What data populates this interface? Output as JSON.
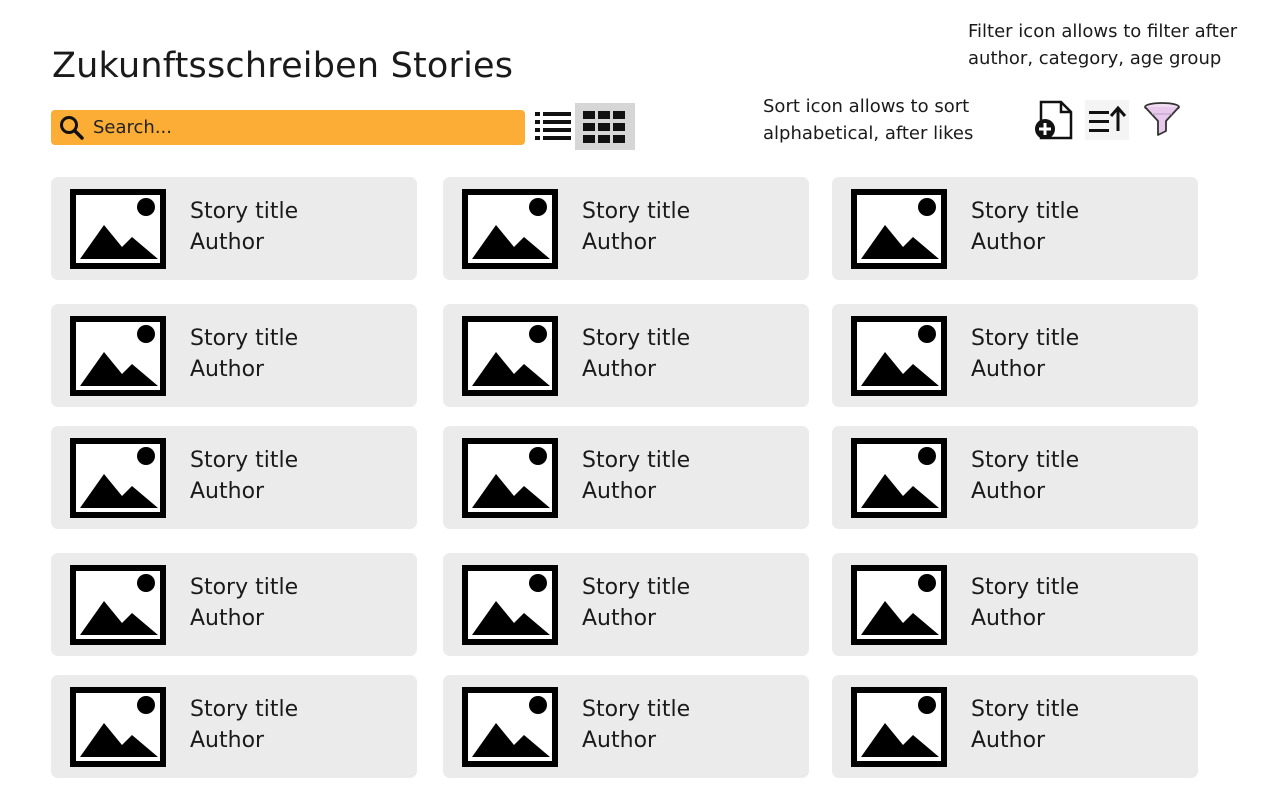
{
  "header": {
    "title": "Zukunftsschreiben Stories"
  },
  "search": {
    "placeholder": "Search...",
    "value": ""
  },
  "toolbar": {
    "view_list_icon": "list-view-icon",
    "view_grid_icon": "grid-view-icon",
    "active_view": "grid",
    "add_icon": "new-document-icon",
    "sort_icon": "sort-ascending-icon",
    "filter_icon": "funnel-icon"
  },
  "annotations": {
    "sort_note": "Sort icon allows to sort alphabetical, after likes",
    "filter_note": "Filter icon allows to filter after author, category, age group"
  },
  "colors": {
    "search_bg": "#fbad35",
    "card_bg": "#ebebeb",
    "active_view_bg": "#d6d6d6"
  },
  "stories": [
    {
      "title": "Story title",
      "author": "Author",
      "image_icon": "image-placeholder-icon"
    },
    {
      "title": "Story title",
      "author": "Author",
      "image_icon": "image-placeholder-icon"
    },
    {
      "title": "Story title",
      "author": "Author",
      "image_icon": "image-placeholder-icon"
    },
    {
      "title": "Story title",
      "author": "Author",
      "image_icon": "image-placeholder-icon"
    },
    {
      "title": "Story title",
      "author": "Author",
      "image_icon": "image-placeholder-icon"
    },
    {
      "title": "Story title",
      "author": "Author",
      "image_icon": "image-placeholder-icon"
    },
    {
      "title": "Story title",
      "author": "Author",
      "image_icon": "image-placeholder-icon"
    },
    {
      "title": "Story title",
      "author": "Author",
      "image_icon": "image-placeholder-icon"
    },
    {
      "title": "Story title",
      "author": "Author",
      "image_icon": "image-placeholder-icon"
    },
    {
      "title": "Story title",
      "author": "Author",
      "image_icon": "image-placeholder-icon"
    },
    {
      "title": "Story title",
      "author": "Author",
      "image_icon": "image-placeholder-icon"
    },
    {
      "title": "Story title",
      "author": "Author",
      "image_icon": "image-placeholder-icon"
    },
    {
      "title": "Story title",
      "author": "Author",
      "image_icon": "image-placeholder-icon"
    },
    {
      "title": "Story title",
      "author": "Author",
      "image_icon": "image-placeholder-icon"
    },
    {
      "title": "Story title",
      "author": "Author",
      "image_icon": "image-placeholder-icon"
    }
  ]
}
